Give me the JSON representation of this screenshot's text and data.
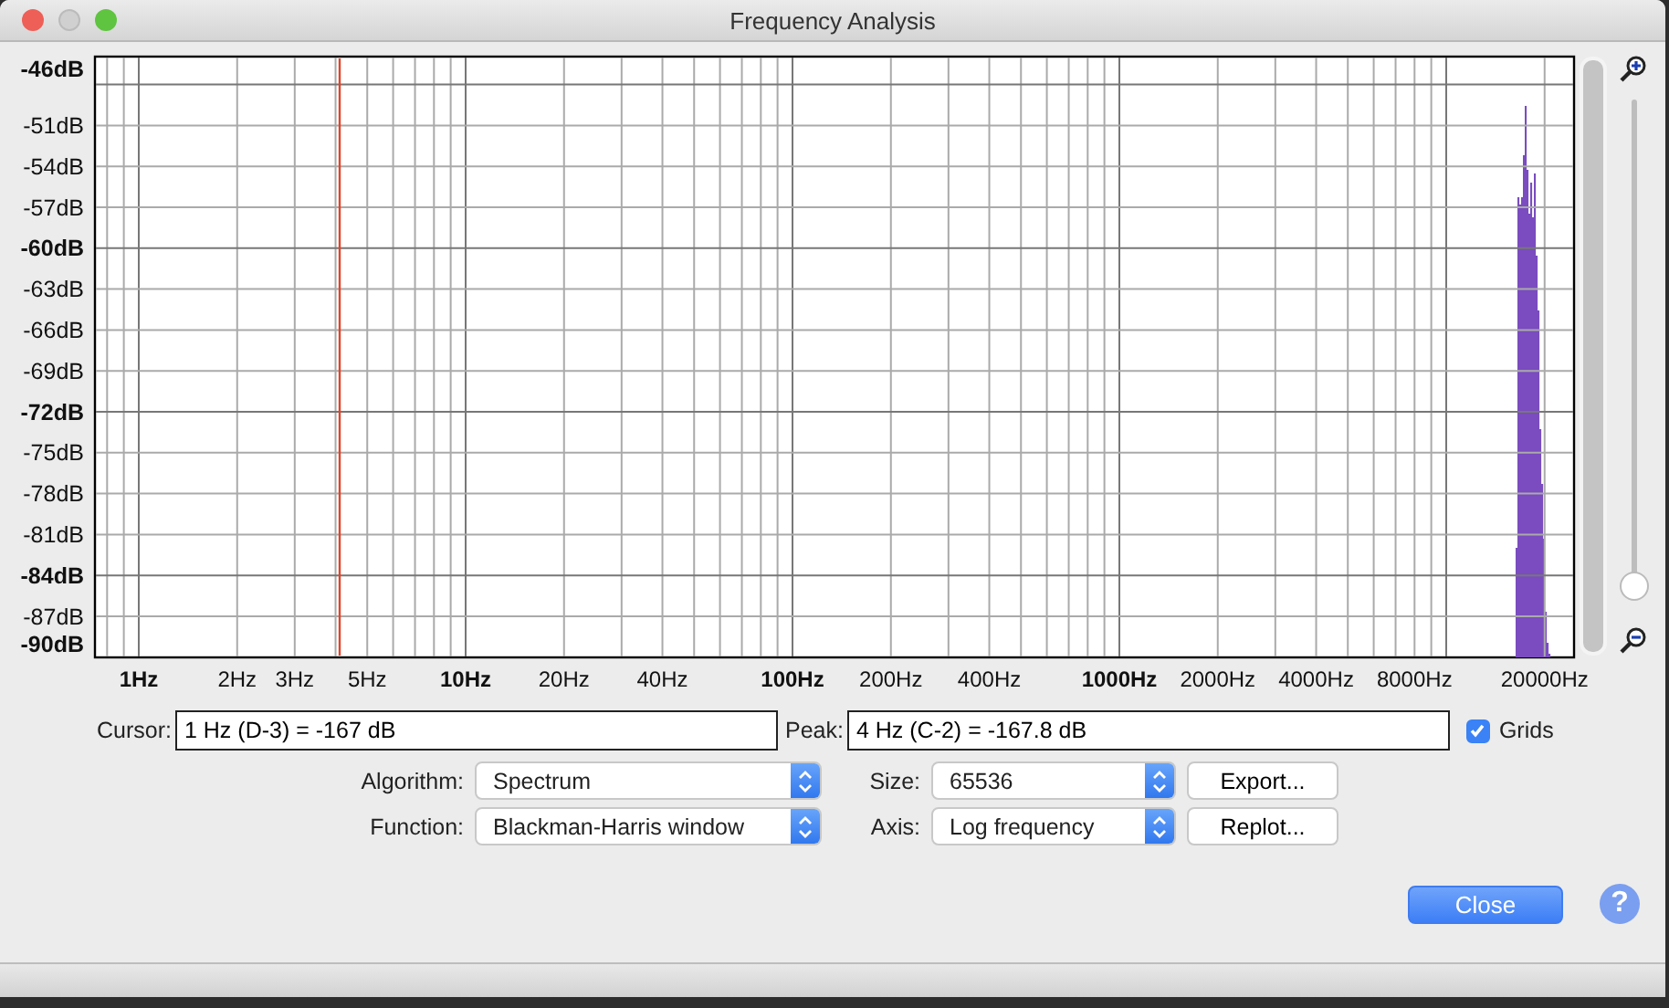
{
  "window": {
    "title": "Frequency Analysis"
  },
  "plot": {
    "y_axis_labels": [
      {
        "text": "-46dB",
        "major": true
      },
      {
        "text": "-51dB",
        "major": false
      },
      {
        "text": "-54dB",
        "major": false
      },
      {
        "text": "-57dB",
        "major": false
      },
      {
        "text": "-60dB",
        "major": true
      },
      {
        "text": "-63dB",
        "major": false
      },
      {
        "text": "-66dB",
        "major": false
      },
      {
        "text": "-69dB",
        "major": false
      },
      {
        "text": "-72dB",
        "major": true
      },
      {
        "text": "-75dB",
        "major": false
      },
      {
        "text": "-78dB",
        "major": false
      },
      {
        "text": "-81dB",
        "major": false
      },
      {
        "text": "-84dB",
        "major": true
      },
      {
        "text": "-87dB",
        "major": false
      },
      {
        "text": "-90dB",
        "major": true
      }
    ],
    "x_axis_labels": [
      {
        "text": "1Hz",
        "major": true
      },
      {
        "text": "2Hz",
        "major": false
      },
      {
        "text": "3Hz",
        "major": false
      },
      {
        "text": "5Hz",
        "major": false
      },
      {
        "text": "10Hz",
        "major": true
      },
      {
        "text": "20Hz",
        "major": false
      },
      {
        "text": "40Hz",
        "major": false
      },
      {
        "text": "100Hz",
        "major": true
      },
      {
        "text": "200Hz",
        "major": false
      },
      {
        "text": "400Hz",
        "major": false
      },
      {
        "text": "1000Hz",
        "major": true
      },
      {
        "text": "2000Hz",
        "major": false
      },
      {
        "text": "4000Hz",
        "major": false
      },
      {
        "text": "8000Hz",
        "major": false
      },
      {
        "text": "20000Hz",
        "major": false
      }
    ]
  },
  "zoom_slider": {
    "level": 0
  },
  "cursor": {
    "label": "Cursor:",
    "value": "1 Hz (D-3) = -167 dB"
  },
  "peak": {
    "label": "Peak:",
    "value": "4 Hz (C-2) = -167.8 dB"
  },
  "grids": {
    "label": "Grids",
    "checked": true
  },
  "settings": [
    {
      "label": "Algorithm:",
      "value": "Spectrum"
    },
    {
      "label": "Size:",
      "value": "65536"
    },
    {
      "label": "Function:",
      "value": "Blackman-Harris window"
    },
    {
      "label": "Axis:",
      "value": "Log frequency"
    }
  ],
  "buttons": [
    {
      "label": "Export..."
    },
    {
      "label": "Replot..."
    }
  ],
  "close_button": {
    "label": "Close"
  },
  "help_button": {
    "label": "?"
  }
}
